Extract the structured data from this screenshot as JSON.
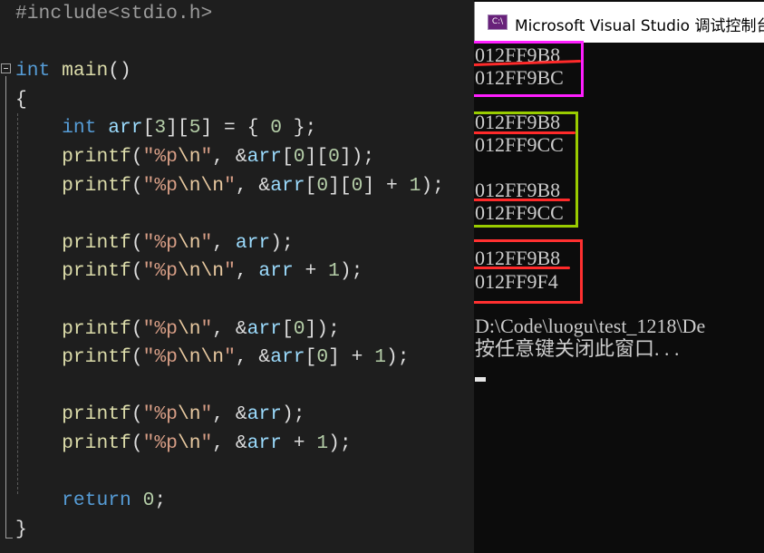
{
  "editor": {
    "lines": [
      [
        [
          "#include",
          "pp"
        ],
        [
          "<stdio.h>",
          "pp"
        ]
      ],
      [],
      [
        [
          "int",
          "kw"
        ],
        [
          " ",
          "pun"
        ],
        [
          "main",
          "fn"
        ],
        [
          "()",
          "pun"
        ]
      ],
      [
        [
          "{",
          "pun"
        ]
      ],
      [
        [
          "    ",
          "pun"
        ],
        [
          "int",
          "kw"
        ],
        [
          " ",
          "pun"
        ],
        [
          "arr",
          "var"
        ],
        [
          "[",
          "pun"
        ],
        [
          "3",
          "num"
        ],
        [
          "][",
          "pun"
        ],
        [
          "5",
          "num"
        ],
        [
          "] = { ",
          "pun"
        ],
        [
          "0",
          "num"
        ],
        [
          " };",
          "pun"
        ]
      ],
      [
        [
          "    ",
          "pun"
        ],
        [
          "printf",
          "fn"
        ],
        [
          "(",
          "pun"
        ],
        [
          "\"%p",
          "str"
        ],
        [
          "\\n",
          "esc"
        ],
        [
          "\"",
          "str"
        ],
        [
          ", &",
          "pun"
        ],
        [
          "arr",
          "var"
        ],
        [
          "[",
          "pun"
        ],
        [
          "0",
          "num"
        ],
        [
          "][",
          "pun"
        ],
        [
          "0",
          "num"
        ],
        [
          "]);",
          "pun"
        ]
      ],
      [
        [
          "    ",
          "pun"
        ],
        [
          "printf",
          "fn"
        ],
        [
          "(",
          "pun"
        ],
        [
          "\"%p",
          "str"
        ],
        [
          "\\n\\n",
          "esc"
        ],
        [
          "\"",
          "str"
        ],
        [
          ", &",
          "pun"
        ],
        [
          "arr",
          "var"
        ],
        [
          "[",
          "pun"
        ],
        [
          "0",
          "num"
        ],
        [
          "][",
          "pun"
        ],
        [
          "0",
          "num"
        ],
        [
          "] + ",
          "pun"
        ],
        [
          "1",
          "num"
        ],
        [
          ");",
          "pun"
        ]
      ],
      [],
      [
        [
          "    ",
          "pun"
        ],
        [
          "printf",
          "fn"
        ],
        [
          "(",
          "pun"
        ],
        [
          "\"%p",
          "str"
        ],
        [
          "\\n",
          "esc"
        ],
        [
          "\"",
          "str"
        ],
        [
          ", ",
          "pun"
        ],
        [
          "arr",
          "var"
        ],
        [
          ");",
          "pun"
        ]
      ],
      [
        [
          "    ",
          "pun"
        ],
        [
          "printf",
          "fn"
        ],
        [
          "(",
          "pun"
        ],
        [
          "\"%p",
          "str"
        ],
        [
          "\\n\\n",
          "esc"
        ],
        [
          "\"",
          "str"
        ],
        [
          ", ",
          "pun"
        ],
        [
          "arr",
          "var"
        ],
        [
          " + ",
          "pun"
        ],
        [
          "1",
          "num"
        ],
        [
          ");",
          "pun"
        ]
      ],
      [],
      [
        [
          "    ",
          "pun"
        ],
        [
          "printf",
          "fn"
        ],
        [
          "(",
          "pun"
        ],
        [
          "\"%p",
          "str"
        ],
        [
          "\\n",
          "esc"
        ],
        [
          "\"",
          "str"
        ],
        [
          ", &",
          "pun"
        ],
        [
          "arr",
          "var"
        ],
        [
          "[",
          "pun"
        ],
        [
          "0",
          "num"
        ],
        [
          "]);",
          "pun"
        ]
      ],
      [
        [
          "    ",
          "pun"
        ],
        [
          "printf",
          "fn"
        ],
        [
          "(",
          "pun"
        ],
        [
          "\"%p",
          "str"
        ],
        [
          "\\n\\n",
          "esc"
        ],
        [
          "\"",
          "str"
        ],
        [
          ", &",
          "pun"
        ],
        [
          "arr",
          "var"
        ],
        [
          "[",
          "pun"
        ],
        [
          "0",
          "num"
        ],
        [
          "] + ",
          "pun"
        ],
        [
          "1",
          "num"
        ],
        [
          ");",
          "pun"
        ]
      ],
      [],
      [
        [
          "    ",
          "pun"
        ],
        [
          "printf",
          "fn"
        ],
        [
          "(",
          "pun"
        ],
        [
          "\"%p",
          "str"
        ],
        [
          "\\n",
          "esc"
        ],
        [
          "\"",
          "str"
        ],
        [
          ", &",
          "pun"
        ],
        [
          "arr",
          "var"
        ],
        [
          ");",
          "pun"
        ]
      ],
      [
        [
          "    ",
          "pun"
        ],
        [
          "printf",
          "fn"
        ],
        [
          "(",
          "pun"
        ],
        [
          "\"%p",
          "str"
        ],
        [
          "\\n",
          "esc"
        ],
        [
          "\"",
          "str"
        ],
        [
          ", &",
          "pun"
        ],
        [
          "arr",
          "var"
        ],
        [
          " + ",
          "pun"
        ],
        [
          "1",
          "num"
        ],
        [
          ");",
          "pun"
        ]
      ],
      [],
      [
        [
          "    ",
          "pun"
        ],
        [
          "return",
          "kw"
        ],
        [
          " ",
          "pun"
        ],
        [
          "0",
          "num"
        ],
        [
          ";",
          "pun"
        ]
      ],
      [
        [
          "}",
          "pun"
        ]
      ]
    ]
  },
  "console": {
    "title": "Microsoft Visual Studio 调试控制台",
    "icon_label": "C:\\",
    "output": [
      "012FF9B8",
      "012FF9BC",
      "012FF9B8",
      "012FF9CC",
      "012FF9B8",
      "012FF9CC",
      "012FF9B8",
      "012FF9F4"
    ],
    "path_line": "D:\\Code\\luogu\\test_1218\\De",
    "prompt": "按任意键关闭此窗口. . ."
  },
  "annotations": {
    "box_colors": [
      "#ff1fff",
      "#99cc00",
      "#ff3030"
    ],
    "underline_color": "#ff2a2a"
  }
}
